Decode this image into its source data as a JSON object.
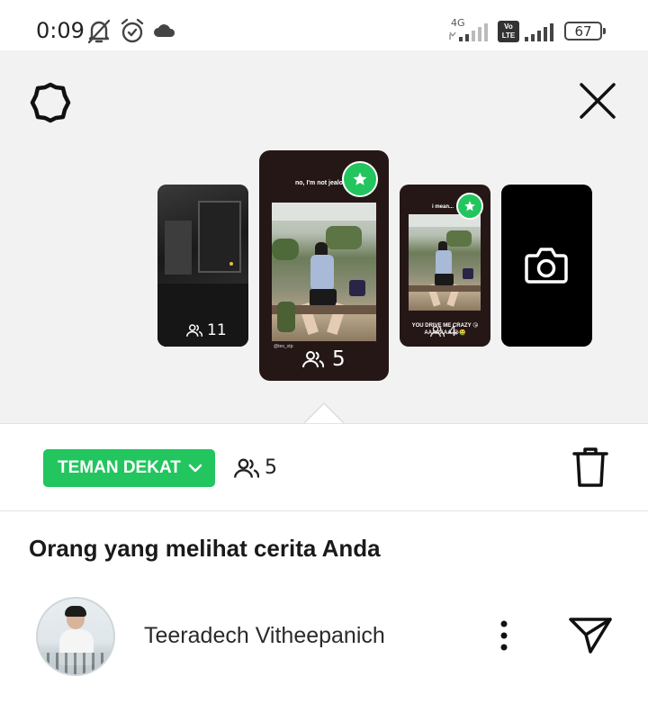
{
  "status_bar": {
    "time": "0:09",
    "network_label": "4G",
    "volte_label": "Vo LTE",
    "battery": "67"
  },
  "stories": [
    {
      "viewers": "11",
      "caption": "",
      "close_friends": false
    },
    {
      "viewers": "5",
      "caption": "no, I'm not jealous",
      "handle": "@teo_vtp",
      "close_friends": true
    },
    {
      "viewers": "4",
      "caption": "i mean...",
      "bottom_caption": "YOU DRIVE ME CRAZY 😘 AAAAAAA 😭🤮",
      "close_friends": true
    },
    {
      "viewers": "",
      "caption": "",
      "is_camera": true
    }
  ],
  "audience": {
    "label": "TEMAN DEKAT",
    "count": "5"
  },
  "viewers_section": {
    "title": "Orang yang melihat cerita Anda",
    "viewers": [
      {
        "name": "Teeradech Vitheepanich"
      }
    ]
  },
  "icons": {
    "settings": "gear-icon",
    "close": "close-icon",
    "camera": "camera-icon",
    "people": "people-icon",
    "star": "star-icon",
    "trash": "trash-icon",
    "more": "more-vertical-icon",
    "send": "send-icon"
  },
  "colors": {
    "accent_green": "#22c55e",
    "story_bg": "#f2f2f2",
    "thumb_dark": "#261717"
  }
}
